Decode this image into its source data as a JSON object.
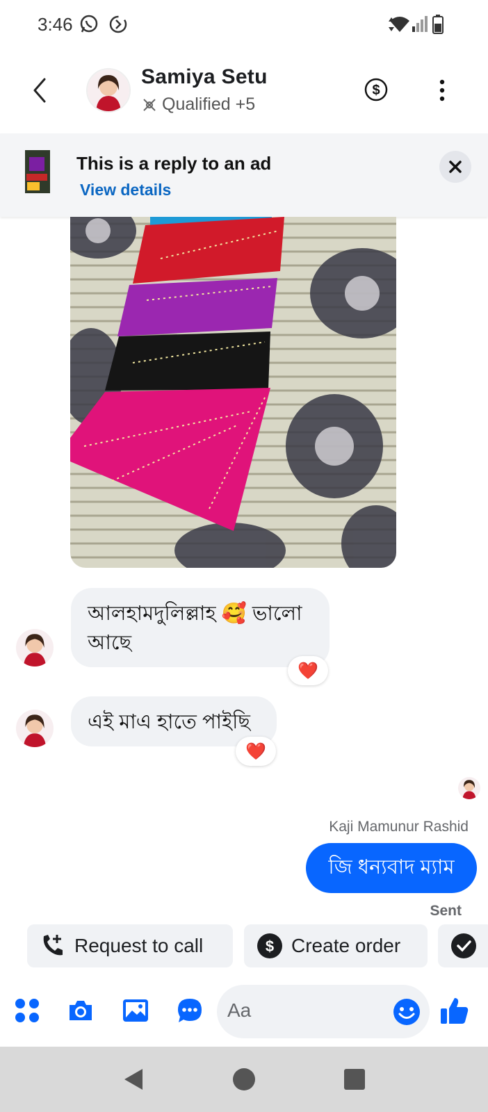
{
  "status_bar": {
    "time": "3:46",
    "icons": [
      "whatsapp-icon",
      "data-saver-icon",
      "data-arrows-icon",
      "wifi-icon",
      "signal-icon",
      "battery-icon"
    ]
  },
  "header": {
    "name": "Samiya Setu",
    "label": "Qualified +5",
    "icons": [
      "back-icon",
      "label-icon",
      "dollar-icon",
      "more-icon"
    ]
  },
  "ad_banner": {
    "title": "This is a reply to an ad",
    "link": "View details"
  },
  "messages": [
    {
      "from": "contact",
      "text": "আলহামদুলিল্লাহ 🥰 ভালো আছে",
      "reaction": "❤️"
    },
    {
      "from": "contact",
      "text": "এই মাএ হাতে পাইছি",
      "reaction": "❤️"
    },
    {
      "from": "me",
      "sender": "Kaji Mamunur Rashid",
      "text": "জি ধন্যবাদ ম্যাম",
      "status": "Sent"
    }
  ],
  "quick_actions": [
    {
      "label": "Request to call",
      "icon": "phone-add-icon"
    },
    {
      "label": "Create order",
      "icon": "dollar-circle-icon"
    },
    {
      "label": "",
      "icon": "check-circle-icon"
    }
  ],
  "composer": {
    "placeholder": "Aa",
    "icons": [
      "apps-icon",
      "camera-icon",
      "gallery-icon",
      "quick-reply-icon",
      "emoji-icon",
      "like-icon"
    ]
  },
  "colors": {
    "accent": "#0866ff",
    "bubble_in": "#f0f2f5",
    "link": "#0a66c2"
  }
}
